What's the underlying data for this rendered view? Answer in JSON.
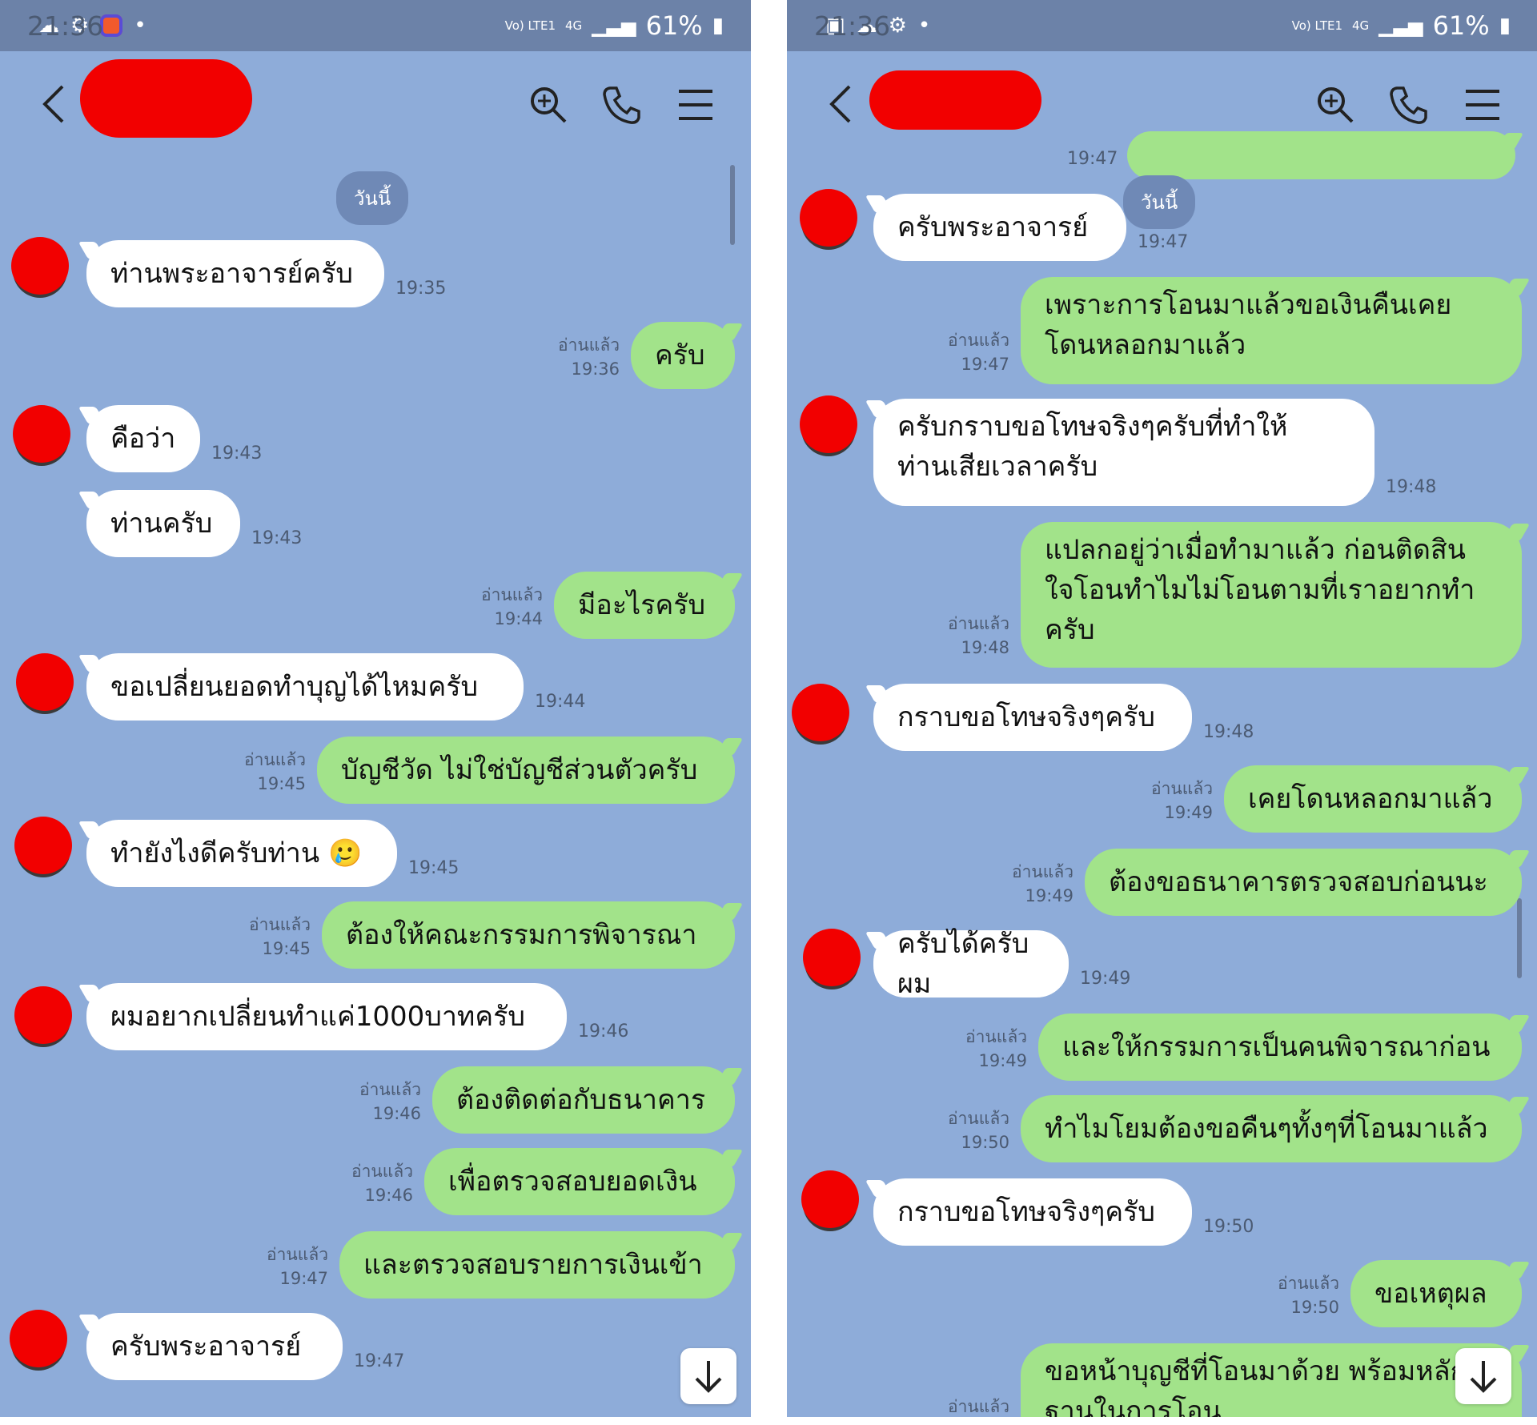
{
  "status_bar": {
    "time": "21:36",
    "battery": "61%",
    "network": "4G",
    "volte": "Vo) LTE1"
  },
  "labels": {
    "read": "อ่านแล้ว",
    "date_divider": "วันนี้"
  },
  "left_panel": {
    "messages": [
      {
        "side": "in",
        "text": "ท่านพระอาจารย์ครับ",
        "time": "19:35"
      },
      {
        "side": "out",
        "text": "ครับ",
        "time": "19:36"
      },
      {
        "side": "in",
        "text": "คือว่า",
        "time": "19:43"
      },
      {
        "side": "in",
        "text": "ท่านครับ",
        "time": "19:43"
      },
      {
        "side": "out",
        "text": "มีอะไรครับ",
        "time": "19:44"
      },
      {
        "side": "in",
        "text": "ขอเปลี่ยนยอดทำบุญได้ไหมครับ",
        "time": "19:44"
      },
      {
        "side": "out",
        "text": "บัญชีวัด ไม่ใช่บัญชีส่วนตัวครับ",
        "time": "19:45"
      },
      {
        "side": "in",
        "text": "ทำยังไงดีครับท่าน 🥲",
        "time": "19:45"
      },
      {
        "side": "out",
        "text": "ต้องให้คณะกรรมการพิจารณา",
        "time": "19:45"
      },
      {
        "side": "in",
        "text": "ผมอยากเปลี่ยนทำแค่1000บาทครับ",
        "time": "19:46"
      },
      {
        "side": "out",
        "text": "ต้องติดต่อกับธนาคาร",
        "time": "19:46"
      },
      {
        "side": "out",
        "text": "เพื่อตรวจสอบยอดเงิน",
        "time": "19:46"
      },
      {
        "side": "out",
        "text": "และตรวจสอบรายการเงินเข้า",
        "time": "19:47"
      },
      {
        "side": "in",
        "text": "ครับพระอาจารย์",
        "time": "19:47"
      }
    ]
  },
  "right_panel": {
    "top_partial_time": "19:47",
    "messages": [
      {
        "side": "in",
        "text": "ครับพระอาจารย์",
        "time": "19:47"
      },
      {
        "side": "out",
        "text": "เพราะการโอนมาแล้วขอเงินคืนเคย\nโดนหลอกมาแล้ว",
        "time": "19:47"
      },
      {
        "side": "in",
        "text": "ครับกราบขอโทษจริงๆครับที่ทำให้\nท่านเสียเวลาครับ",
        "time": "19:48"
      },
      {
        "side": "out",
        "text": "แปลกอยู่ว่าเมื่อทำมาแล้ว ก่อนติดสิน\nใจโอนทำไมไม่โอนตามที่เราอยากทำ\nครับ",
        "time": "19:48"
      },
      {
        "side": "in",
        "text": "กราบขอโทษจริงๆครับ",
        "time": "19:48"
      },
      {
        "side": "out",
        "text": "เคยโดนหลอกมาแล้ว",
        "time": "19:49"
      },
      {
        "side": "out",
        "text": "ต้องขอธนาคารตรวจสอบก่อนนะ",
        "time": "19:49"
      },
      {
        "side": "in",
        "text": "ครับได้ครับผม",
        "time": "19:49"
      },
      {
        "side": "out",
        "text": "และให้กรรมการเป็นคนพิจารณาก่อน",
        "time": "19:49"
      },
      {
        "side": "out",
        "text": "ทำไมโยมต้องขอคืนๆทั้งๆที่โอนมาแล้ว",
        "time": "19:50"
      },
      {
        "side": "in",
        "text": "กราบขอโทษจริงๆครับ",
        "time": "19:50"
      },
      {
        "side": "out",
        "text": "ขอเหตุผล",
        "time": "19:50"
      },
      {
        "side": "out",
        "text": "ขอหน้าบุญชีที่โอนมาด้วย พร้อมหลัก\nฐานในการโอน",
        "time": ""
      }
    ]
  }
}
